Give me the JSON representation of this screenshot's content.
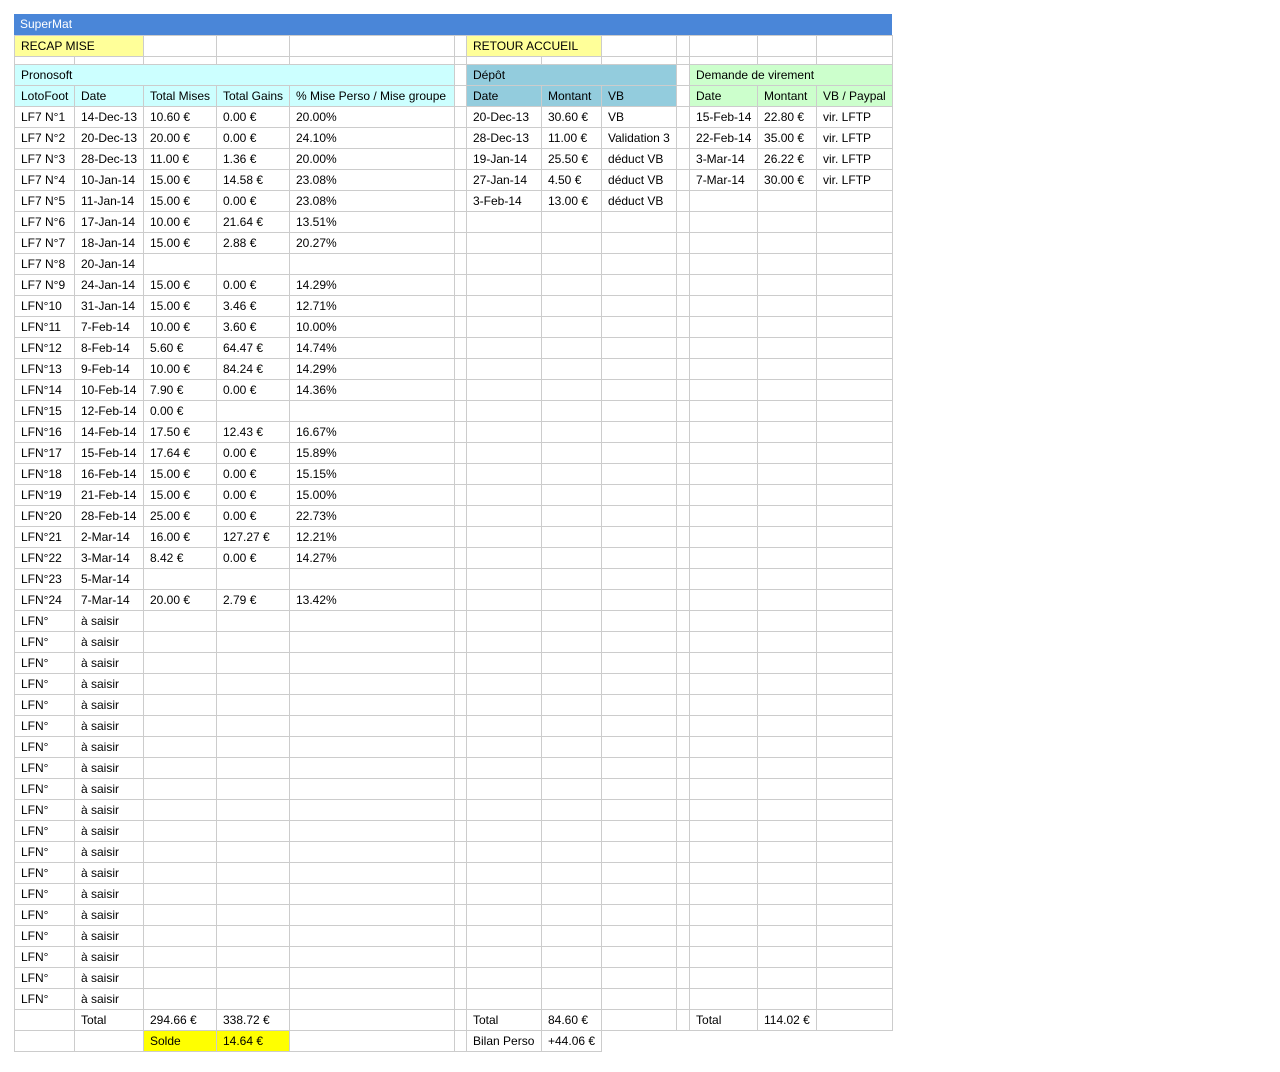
{
  "app": {
    "title": "SuperMat"
  },
  "nav": {
    "recap_label": "RECAP MISE",
    "home_label": "RETOUR ACCUEIL"
  },
  "colors": {
    "title_bar": "#4a86d8",
    "pronosoft_header": "#ccffff",
    "depot_header": "#93ccdd",
    "virement_header": "#ccffcc",
    "button": "#ffff99",
    "solde": "#ffff00"
  },
  "pronosoft": {
    "header": "Pronosoft",
    "columns": [
      "LotoFoot",
      "Date",
      "Total Mises",
      "Total Gains",
      "% Mise Perso / Mise groupe"
    ],
    "rows": [
      [
        "LF7 N°1",
        "14-Dec-13",
        "10.60 €",
        "0.00 €",
        "20.00%"
      ],
      [
        "LF7 N°2",
        "20-Dec-13",
        "20.00 €",
        "0.00 €",
        "24.10%"
      ],
      [
        "LF7 N°3",
        "28-Dec-13",
        "11.00 €",
        "1.36 €",
        "20.00%"
      ],
      [
        "LF7 N°4",
        "10-Jan-14",
        "15.00 €",
        "14.58 €",
        "23.08%"
      ],
      [
        "LF7 N°5",
        "11-Jan-14",
        "15.00 €",
        "0.00 €",
        "23.08%"
      ],
      [
        "LF7 N°6",
        "17-Jan-14",
        "10.00 €",
        "21.64 €",
        "13.51%"
      ],
      [
        "LF7 N°7",
        "18-Jan-14",
        "15.00 €",
        "2.88 €",
        "20.27%"
      ],
      [
        "LF7 N°8",
        "20-Jan-14",
        "",
        "",
        ""
      ],
      [
        "LF7 N°9",
        "24-Jan-14",
        "15.00 €",
        "0.00 €",
        "14.29%"
      ],
      [
        "LFN°10",
        "31-Jan-14",
        "15.00 €",
        "3.46 €",
        "12.71%"
      ],
      [
        "LFN°11",
        "7-Feb-14",
        "10.00 €",
        "3.60 €",
        "10.00%"
      ],
      [
        "LFN°12",
        "8-Feb-14",
        "5.60 €",
        "64.47 €",
        "14.74%"
      ],
      [
        "LFN°13",
        "9-Feb-14",
        "10.00 €",
        "84.24 €",
        "14.29%"
      ],
      [
        "LFN°14",
        "10-Feb-14",
        "7.90 €",
        "0.00 €",
        "14.36%"
      ],
      [
        "LFN°15",
        "12-Feb-14",
        "0.00 €",
        "",
        ""
      ],
      [
        "LFN°16",
        "14-Feb-14",
        "17.50 €",
        "12.43 €",
        "16.67%"
      ],
      [
        "LFN°17",
        "15-Feb-14",
        "17.64 €",
        "0.00 €",
        "15.89%"
      ],
      [
        "LFN°18",
        "16-Feb-14",
        "15.00 €",
        "0.00 €",
        "15.15%"
      ],
      [
        "LFN°19",
        "21-Feb-14",
        "15.00 €",
        "0.00 €",
        "15.00%"
      ],
      [
        "LFN°20",
        "28-Feb-14",
        "25.00 €",
        "0.00 €",
        "22.73%"
      ],
      [
        "LFN°21",
        "2-Mar-14",
        "16.00 €",
        "127.27 €",
        "12.21%"
      ],
      [
        "LFN°22",
        "3-Mar-14",
        "8.42 €",
        "0.00 €",
        "14.27%"
      ],
      [
        "LFN°23",
        "5-Mar-14",
        "",
        "",
        ""
      ],
      [
        "LFN°24",
        "7-Mar-14",
        "20.00 €",
        "2.79 €",
        "13.42%"
      ],
      [
        "LFN°",
        "à saisir",
        "",
        "",
        ""
      ],
      [
        "LFN°",
        "à saisir",
        "",
        "",
        ""
      ],
      [
        "LFN°",
        "à saisir",
        "",
        "",
        ""
      ],
      [
        "LFN°",
        "à saisir",
        "",
        "",
        ""
      ],
      [
        "LFN°",
        "à saisir",
        "",
        "",
        ""
      ],
      [
        "LFN°",
        "à saisir",
        "",
        "",
        ""
      ],
      [
        "LFN°",
        "à saisir",
        "",
        "",
        ""
      ],
      [
        "LFN°",
        "à saisir",
        "",
        "",
        ""
      ],
      [
        "LFN°",
        "à saisir",
        "",
        "",
        ""
      ],
      [
        "LFN°",
        "à saisir",
        "",
        "",
        ""
      ],
      [
        "LFN°",
        "à saisir",
        "",
        "",
        ""
      ],
      [
        "LFN°",
        "à saisir",
        "",
        "",
        ""
      ],
      [
        "LFN°",
        "à saisir",
        "",
        "",
        ""
      ],
      [
        "LFN°",
        "à saisir",
        "",
        "",
        ""
      ],
      [
        "LFN°",
        "à saisir",
        "",
        "",
        ""
      ],
      [
        "LFN°",
        "à saisir",
        "",
        "",
        ""
      ],
      [
        "LFN°",
        "à saisir",
        "",
        "",
        ""
      ],
      [
        "LFN°",
        "à saisir",
        "",
        "",
        ""
      ],
      [
        "LFN°",
        "à saisir",
        "",
        "",
        ""
      ]
    ],
    "total_label": "Total",
    "total_mises": "294.66 €",
    "total_gains": "338.72 €",
    "solde_label": "Solde",
    "solde_value": "14.64 €"
  },
  "depot": {
    "header": "Dépôt",
    "columns": [
      "Date",
      "Montant",
      "VB"
    ],
    "rows": [
      [
        "20-Dec-13",
        "30.60 €",
        "VB"
      ],
      [
        "28-Dec-13",
        "11.00 €",
        "Validation 3"
      ],
      [
        "19-Jan-14",
        "25.50 €",
        "déduct VB"
      ],
      [
        "27-Jan-14",
        "4.50 €",
        "déduct VB"
      ],
      [
        "3-Feb-14",
        "13.00 €",
        "déduct VB"
      ]
    ],
    "total_label": "Total",
    "total_value": "84.60 €",
    "bilan_label": "Bilan Perso",
    "bilan_value": "+44.06 €"
  },
  "virement": {
    "header": "Demande de virement",
    "columns": [
      "Date",
      "Montant",
      "VB / Paypal"
    ],
    "rows": [
      [
        "15-Feb-14",
        "22.80 €",
        "vir. LFTP"
      ],
      [
        "22-Feb-14",
        "35.00 €",
        "vir. LFTP"
      ],
      [
        "3-Mar-14",
        "26.22 €",
        "vir. LFTP"
      ],
      [
        "7-Mar-14",
        "30.00 €",
        "vir. LFTP"
      ]
    ],
    "total_label": "Total",
    "total_value": "114.02 €"
  }
}
